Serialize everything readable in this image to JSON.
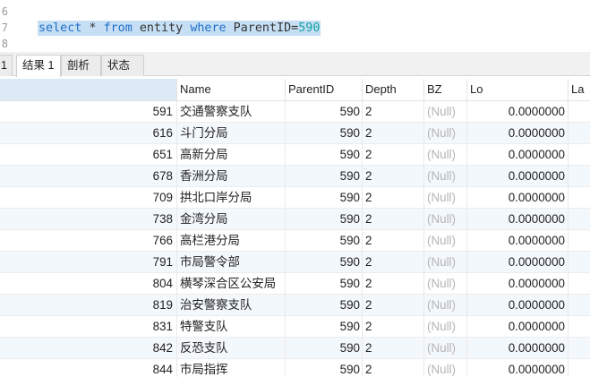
{
  "editor": {
    "line_numbers": [
      "6",
      "7",
      "8"
    ],
    "query": {
      "kw_select": "select",
      "star": " * ",
      "kw_from": "from",
      "table": " entity ",
      "kw_where": "where",
      "condition": " ParentID=",
      "value": "590"
    }
  },
  "tabs": [
    {
      "label": "1"
    },
    {
      "label": "结果 1",
      "active": true
    },
    {
      "label": "剖析"
    },
    {
      "label": "状态"
    }
  ],
  "grid": {
    "columns": [
      "",
      "Name",
      "ParentID",
      "Depth",
      "BZ",
      "Lo",
      "La"
    ],
    "rows": [
      {
        "id": "591",
        "name": "交通警察支队",
        "parent_id": "590",
        "depth": "2",
        "bz": "(Null)",
        "lo": "0.0000000"
      },
      {
        "id": "616",
        "name": "斗门分局",
        "parent_id": "590",
        "depth": "2",
        "bz": "(Null)",
        "lo": "0.0000000"
      },
      {
        "id": "651",
        "name": "高新分局",
        "parent_id": "590",
        "depth": "2",
        "bz": "(Null)",
        "lo": "0.0000000"
      },
      {
        "id": "678",
        "name": "香洲分局",
        "parent_id": "590",
        "depth": "2",
        "bz": "(Null)",
        "lo": "0.0000000"
      },
      {
        "id": "709",
        "name": "拱北口岸分局",
        "parent_id": "590",
        "depth": "2",
        "bz": "(Null)",
        "lo": "0.0000000"
      },
      {
        "id": "738",
        "name": "金湾分局",
        "parent_id": "590",
        "depth": "2",
        "bz": "(Null)",
        "lo": "0.0000000"
      },
      {
        "id": "766",
        "name": "高栏港分局",
        "parent_id": "590",
        "depth": "2",
        "bz": "(Null)",
        "lo": "0.0000000"
      },
      {
        "id": "791",
        "name": "市局警令部",
        "parent_id": "590",
        "depth": "2",
        "bz": "(Null)",
        "lo": "0.0000000"
      },
      {
        "id": "804",
        "name": "横琴深合区公安局",
        "parent_id": "590",
        "depth": "2",
        "bz": "(Null)",
        "lo": "0.0000000"
      },
      {
        "id": "819",
        "name": "治安警察支队",
        "parent_id": "590",
        "depth": "2",
        "bz": "(Null)",
        "lo": "0.0000000"
      },
      {
        "id": "831",
        "name": "特警支队",
        "parent_id": "590",
        "depth": "2",
        "bz": "(Null)",
        "lo": "0.0000000"
      },
      {
        "id": "842",
        "name": "反恐支队",
        "parent_id": "590",
        "depth": "2",
        "bz": "(Null)",
        "lo": "0.0000000"
      },
      {
        "id": "844",
        "name": "市局指挥",
        "parent_id": "590",
        "depth": "2",
        "bz": "(Null)",
        "lo": "0.0000000"
      }
    ]
  }
}
